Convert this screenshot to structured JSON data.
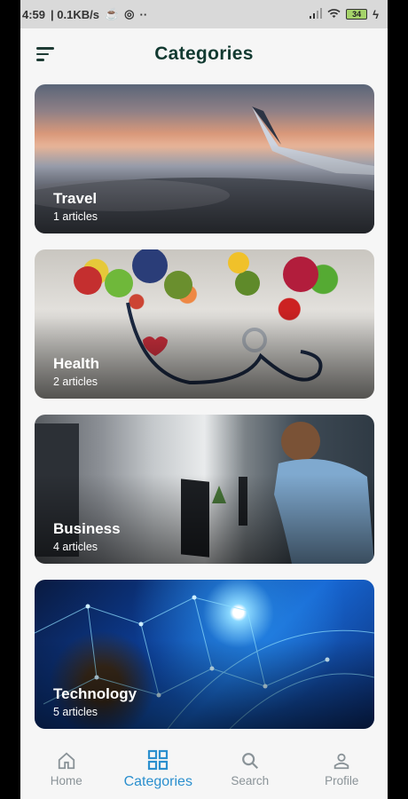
{
  "status_bar": {
    "time": "4:59",
    "speed": "| 0.1KB/s",
    "extra": "··",
    "battery": "34"
  },
  "header": {
    "title": "Categories"
  },
  "categories": [
    {
      "name": "Travel",
      "count": "1 articles"
    },
    {
      "name": "Health",
      "count": "2 articles"
    },
    {
      "name": "Business",
      "count": "4 articles"
    },
    {
      "name": "Technology",
      "count": "5 articles"
    }
  ],
  "nav": {
    "items": [
      {
        "label": "Home",
        "icon": "home-icon"
      },
      {
        "label": "Categories",
        "icon": "grid-icon"
      },
      {
        "label": "Search",
        "icon": "search-icon"
      },
      {
        "label": "Profile",
        "icon": "person-icon"
      }
    ],
    "active": "Categories",
    "active_color": "#2b8fce",
    "inactive_color": "#8a9398"
  }
}
